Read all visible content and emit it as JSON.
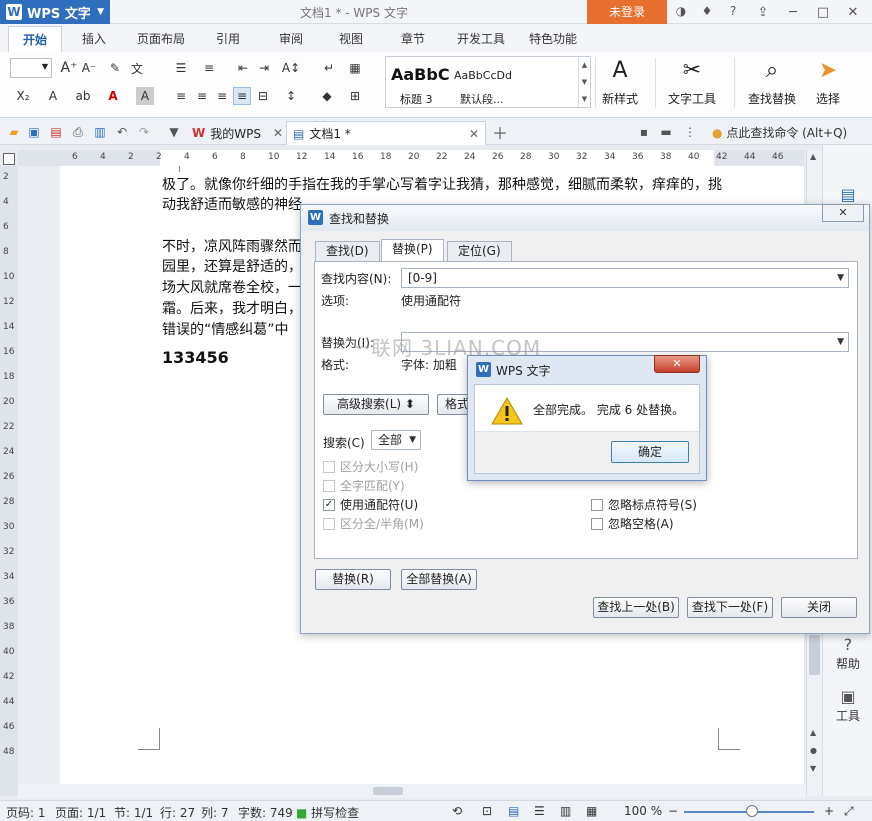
{
  "app": {
    "name": "WPS 文字",
    "doc_title": "文档1 * - WPS 文字",
    "login": "未登录"
  },
  "menu": [
    "开始",
    "插入",
    "页面布局",
    "引用",
    "审阅",
    "视图",
    "章节",
    "开发工具",
    "特色功能"
  ],
  "ribbon": {
    "style_preview_1": "AaBbC",
    "style_preview_2": "AaBbCcDd",
    "style_label_1": "标题 3",
    "style_label_2": "默认段...",
    "new_style": "新样式",
    "text_tools": "文字工具",
    "find_replace": "查找替换",
    "select": "选择"
  },
  "doctabs": {
    "my_wps": "我的WPS",
    "doc1": "文档1 *",
    "search_hint": "点此查找命令 (Alt+Q)"
  },
  "ruler": {
    "h_ticks": [
      "6",
      "4",
      "2",
      "2",
      "4",
      "6",
      "8",
      "10",
      "12",
      "14",
      "16",
      "18",
      "20",
      "22",
      "24",
      "26",
      "28",
      "30",
      "32",
      "34",
      "36",
      "38",
      "40",
      "42",
      "44",
      "46"
    ],
    "v_ticks": [
      "2",
      "4",
      "6",
      "8",
      "10",
      "12",
      "14",
      "16",
      "18",
      "20",
      "22",
      "24",
      "26",
      "28",
      "30",
      "32",
      "34",
      "36",
      "38",
      "40",
      "42",
      "44",
      "46",
      "48"
    ]
  },
  "document": {
    "lines": [
      "极了。就像你纤细的手指在我的手掌心写着字让我猜，那种感觉，细腻而柔软，痒痒的，挑",
      "动我舒适而敏感的神经",
      "不时，凉风阵雨骤然而",
      "园里，还算是舒适的，",
      "场大风就席卷全校，一",
      "霜。后来，我才明白，",
      "错误的“情感纠葛”中"
    ],
    "bold_number": "133456"
  },
  "find_dialog": {
    "title": "查找和替换",
    "tabs": [
      "查找(D)",
      "替换(P)",
      "定位(G)"
    ],
    "find_label": "查找内容(N):",
    "find_value": "[0-9]",
    "options_label": "选项:",
    "options_value": "使用通配符",
    "replace_label": "替换为(I):",
    "replace_value": "",
    "format_label": "格式:",
    "format_value": "字体: 加粗",
    "advanced_btn": "高级搜索(L) ⬍",
    "format_btn": "格式",
    "search_label": "搜索(C)",
    "search_value": "全部",
    "checks": {
      "match_case": "区分大小写(H)",
      "whole_word": "全字匹配(Y)",
      "wildcards": "使用通配符(U)",
      "width": "区分全/半角(M)",
      "ignore_punct": "忽略标点符号(S)",
      "ignore_space": "忽略空格(A)"
    },
    "replace_btn": "替换(R)",
    "replace_all_btn": "全部替换(A)",
    "find_prev_btn": "查找上一处(B)",
    "find_next_btn": "查找下一处(F)",
    "close_btn": "关闭"
  },
  "message_box": {
    "title": "WPS 文字",
    "text": "全部完成。 完成 6 处替换。",
    "ok": "确定"
  },
  "side": {
    "help": "帮助",
    "tools": "工具"
  },
  "status": {
    "page": "页码: 1",
    "pages": "页面: 1/1",
    "section": "节: 1/1",
    "row": "行: 27",
    "col": "列: 7",
    "words": "字数: 749",
    "spell": "拼写检查",
    "zoom": "100 %"
  },
  "watermark": "一联网 3LIAN.COM"
}
